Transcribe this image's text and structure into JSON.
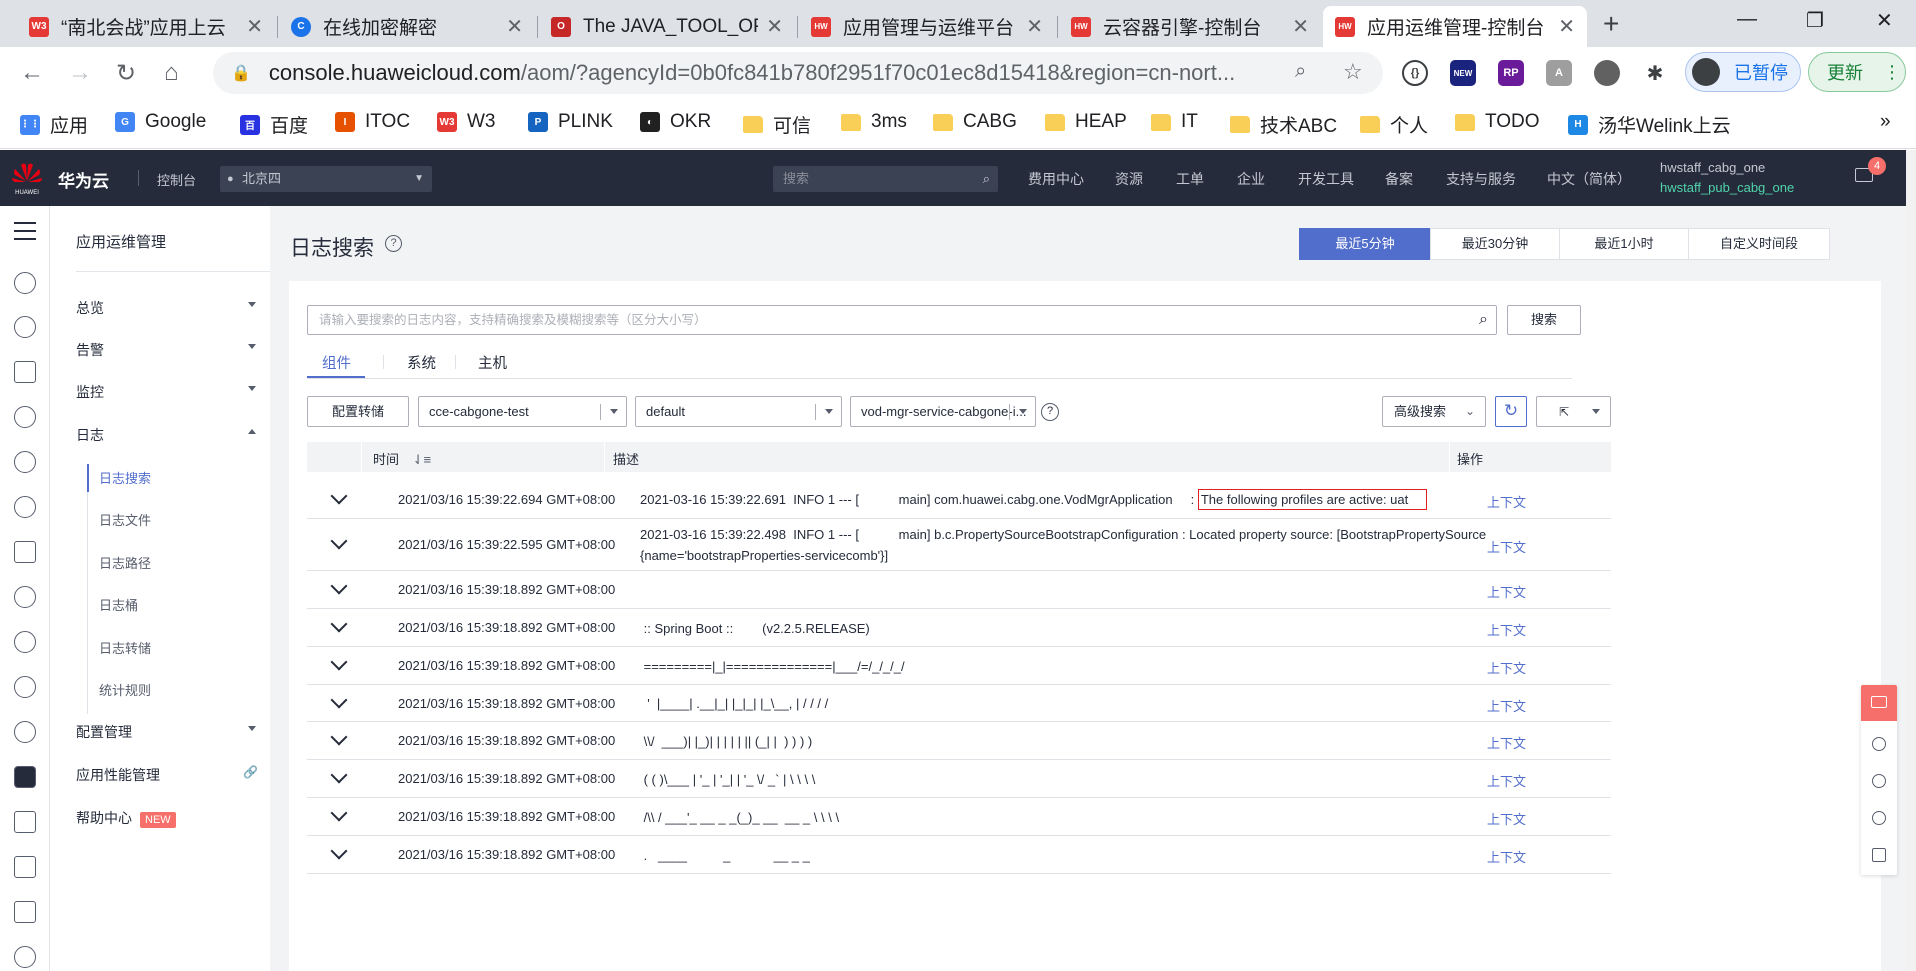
{
  "browser": {
    "tabs": [
      {
        "label": "“南北会战”应用上云",
        "favicon": "W3",
        "color": "#e53935"
      },
      {
        "label": "在线加密解密",
        "favicon": "C",
        "color": "#1a73e8"
      },
      {
        "label": "The JAVA_TOOL_OP",
        "favicon": "O",
        "color": "#c62828"
      },
      {
        "label": "应用管理与运维平台",
        "favicon": "HW",
        "color": "#e53935"
      },
      {
        "label": "云容器引擎-控制台",
        "favicon": "HW",
        "color": "#e53935"
      },
      {
        "label": "应用运维管理-控制台",
        "favicon": "HW",
        "color": "#e53935"
      }
    ],
    "url_host": "console.huaweicloud.com",
    "url_path": "/aom/?agencyId=0b0fc841b780f2951f70c01ec8d15418&region=cn-nort...",
    "paused_label": "已暂停",
    "update_label": "更新",
    "bookmarks": [
      {
        "label": "应用",
        "icon": "apps-icon"
      },
      {
        "label": "Google",
        "icon": "google-icon"
      },
      {
        "label": "百度",
        "icon": "baidu-icon"
      },
      {
        "label": "ITOC",
        "icon": "itoc-icon"
      },
      {
        "label": "W3",
        "icon": "w3-icon"
      },
      {
        "label": "PLINK",
        "icon": "plink-icon"
      },
      {
        "label": "OKR",
        "icon": "okr-icon"
      },
      {
        "label": "可信",
        "icon": "folder-icon"
      },
      {
        "label": "3ms",
        "icon": "folder-icon"
      },
      {
        "label": "CABG",
        "icon": "folder-icon"
      },
      {
        "label": "HEAP",
        "icon": "folder-icon"
      },
      {
        "label": "IT",
        "icon": "folder-icon"
      },
      {
        "label": "技术ABC",
        "icon": "folder-icon"
      },
      {
        "label": "个人",
        "icon": "folder-icon"
      },
      {
        "label": "TODO",
        "icon": "folder-icon"
      },
      {
        "label": "汤华Welink上云",
        "icon": "welink-icon"
      }
    ]
  },
  "console": {
    "brand": "华为云",
    "logo_text": "HUAWEI",
    "console_label": "控制台",
    "region": "北京四",
    "search_placeholder": "搜索",
    "nav": [
      "费用中心",
      "资源",
      "工单",
      "企业",
      "开发工具",
      "备案",
      "支持与服务",
      "中文（简体）"
    ],
    "user_primary": "hwstaff_cabg_one",
    "user_secondary": "hwstaff_pub_cabg_one",
    "mail_count": "4"
  },
  "sidebar": {
    "title": "应用运维管理",
    "items": [
      {
        "label": "总览"
      },
      {
        "label": "告警"
      },
      {
        "label": "监控"
      },
      {
        "label": "日志"
      }
    ],
    "log_sub": [
      "日志搜索",
      "日志文件",
      "日志路径",
      "日志桶",
      "日志转储",
      "统计规则"
    ],
    "after": [
      {
        "label": "配置管理"
      },
      {
        "label": "应用性能管理"
      },
      {
        "label": "帮助中心",
        "badge": "NEW"
      }
    ]
  },
  "page": {
    "title": "日志搜索",
    "time_ranges": [
      "最近5分钟",
      "最近30分钟",
      "最近1小时",
      "自定义时间段"
    ],
    "search_placeholder": "请输入要搜索的日志内容，支持精确搜索及模糊搜索等（区分大小写）",
    "search_button": "搜索",
    "tabs": [
      "组件",
      "系统",
      "主机"
    ],
    "config_button": "配置转储",
    "filters": [
      "cce-cabgone-test",
      "default",
      "vod-mgr-service-cabgone-i..."
    ],
    "advanced_search": "高级搜索",
    "columns": {
      "time": "时间",
      "desc": "描述",
      "ops": "操作"
    },
    "context_label": "上下文",
    "rows": [
      {
        "time": "2021/03/16 15:39:22.694 GMT+08:00",
        "desc_pre": "2021-03-16 15:39:22.691  INFO 1 --- [           main] com.huawei.cabg.one.VodMgrApplication     : ",
        "desc_hl": "The following profiles are active: uat"
      },
      {
        "time": "2021/03/16 15:39:22.595 GMT+08:00",
        "desc": "2021-03-16 15:39:22.498  INFO 1 --- [           main] b.c.PropertySourceBootstrapConfiguration : Located property source: [BootstrapPropertySource\n{name='bootstrapProperties-servicecomb'}]"
      },
      {
        "time": "2021/03/16 15:39:18.892 GMT+08:00",
        "desc": ""
      },
      {
        "time": "2021/03/16 15:39:18.892 GMT+08:00",
        "desc": " :: Spring Boot ::        (v2.2.5.RELEASE)"
      },
      {
        "time": "2021/03/16 15:39:18.892 GMT+08:00",
        "desc": " =========|_|==============|___/=/_/_/_/"
      },
      {
        "time": "2021/03/16 15:39:18.892 GMT+08:00",
        "desc": "  '  |____| .__|_| |_|_| |_\\__, | / / / /"
      },
      {
        "time": "2021/03/16 15:39:18.892 GMT+08:00",
        "desc": " \\\\/  ___)| |_)| | | | | || (_| |  ) ) ) )"
      },
      {
        "time": "2021/03/16 15:39:18.892 GMT+08:00",
        "desc": " ( ( )\\___ | '_ | '_| | '_ \\/ _` | \\ \\ \\ \\"
      },
      {
        "time": "2021/03/16 15:39:18.892 GMT+08:00",
        "desc": " /\\\\ / ___'_ __ _ _(_)_ __  __ _ \\ \\ \\ \\"
      },
      {
        "time": "2021/03/16 15:39:18.892 GMT+08:00",
        "desc": " .   ____          _            __ _ _"
      }
    ]
  }
}
